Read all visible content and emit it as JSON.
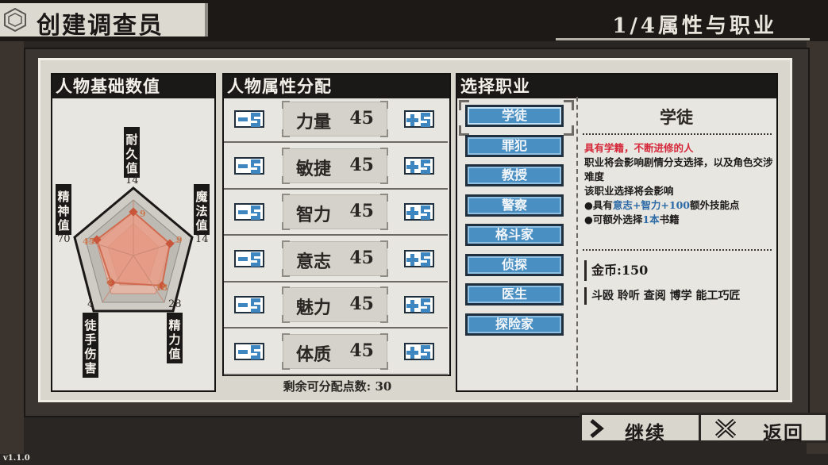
{
  "header": {
    "title": "创建调查员",
    "step": "1/4属性与职业"
  },
  "basic_stats": {
    "heading": "人物基础数值",
    "vertices": [
      {
        "label": "耐久值",
        "value": "14"
      },
      {
        "label": "魔法值",
        "value": "14"
      },
      {
        "label": "精力值",
        "value": "28"
      },
      {
        "label": "徒手伤害",
        "value": "4"
      },
      {
        "label": "精神值",
        "value": "70"
      }
    ],
    "radar_values": [
      "9",
      "9",
      "18",
      "2",
      "45"
    ]
  },
  "attributes": {
    "heading": "人物属性分配",
    "items": [
      {
        "name": "力量",
        "value": "45"
      },
      {
        "name": "敏捷",
        "value": "45"
      },
      {
        "name": "智力",
        "value": "45"
      },
      {
        "name": "意志",
        "value": "45"
      },
      {
        "name": "魅力",
        "value": "45"
      },
      {
        "name": "体质",
        "value": "45"
      }
    ],
    "remaining_label": "剩余可分配点数:",
    "remaining_value": "30"
  },
  "profession": {
    "heading": "选择职业",
    "classes": [
      "学徒",
      "罪犯",
      "教授",
      "警察",
      "格斗家",
      "侦探",
      "医生",
      "探险家"
    ],
    "selected_title": "学徒",
    "desc_red": "具有学籍，不断进修的人",
    "desc_line1": "职业将会影响剧情分支选择，以及角色交涉难度",
    "desc_line2": "该职业选择将会影响",
    "bullet1_prefix": "●具有",
    "bullet1_blue": "意志+智力+100",
    "bullet1_suffix": "额外技能点",
    "bullet2_prefix": "●可额外选择",
    "bullet2_blue": "1本",
    "bullet2_suffix": "书籍",
    "gold": "金币:150",
    "skills": "斗殴 聆听 查阅 博学 能工巧匠"
  },
  "nav": {
    "continue": "继续",
    "back": "返回"
  },
  "version": "v1.1.0",
  "colors": {
    "class_button": "#4a8fc2",
    "highlight_red": "#d5283a",
    "highlight_blue": "#2b6aa6",
    "radar_fill": "#e79a86"
  }
}
